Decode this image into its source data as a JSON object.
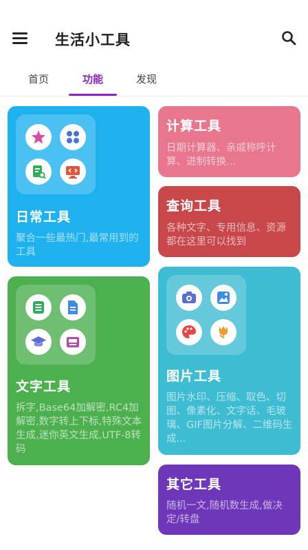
{
  "appbar": {
    "title": "生活小工具",
    "menu_icon": "hamburger-menu-icon",
    "search_icon": "search-icon"
  },
  "tabs": [
    {
      "label": "首页",
      "active": false
    },
    {
      "label": "功能",
      "active": true
    },
    {
      "label": "发现",
      "active": false
    }
  ],
  "accent_color": "#8a22c8",
  "cards": {
    "daily": {
      "title": "日常工具",
      "desc": "聚合一些最热门,最常用到的工具",
      "color": "#1eb1f0",
      "icons": [
        "star-icon",
        "four-petal-icon",
        "document-search-icon",
        "code-monitor-icon"
      ]
    },
    "calc": {
      "title": "计算工具",
      "desc": "日期计算器、亲戚称呼计算、进制转换...",
      "color": "#e8768e"
    },
    "query": {
      "title": "查询工具",
      "desc": "各种文字、专用信息、资源都在这里可以找到",
      "color": "#c8474a"
    },
    "text": {
      "title": "文字工具",
      "desc": "拆字,Base64加解密,RC4加解密,数字转上下标,特殊文本生成,迷你英文生成,UTF-8转码",
      "color": "#4cb04f",
      "icons": [
        "text-list-icon",
        "document-icon",
        "graduation-cap-icon",
        "inbox-icon"
      ]
    },
    "image": {
      "title": "图片工具",
      "desc": "图片水印、压缩、取色、切图、像素化、文字话、毛玻璃、GIF图片分解、二维码生成...",
      "color": "#3ebcd2",
      "icons": [
        "camera-icon",
        "landscape-image-icon",
        "palette-icon",
        "tulip-icon"
      ]
    },
    "other": {
      "title": "其它工具",
      "desc": "随机一文,随机数生成,做决定/转盘",
      "color": "#6e36b8"
    }
  }
}
